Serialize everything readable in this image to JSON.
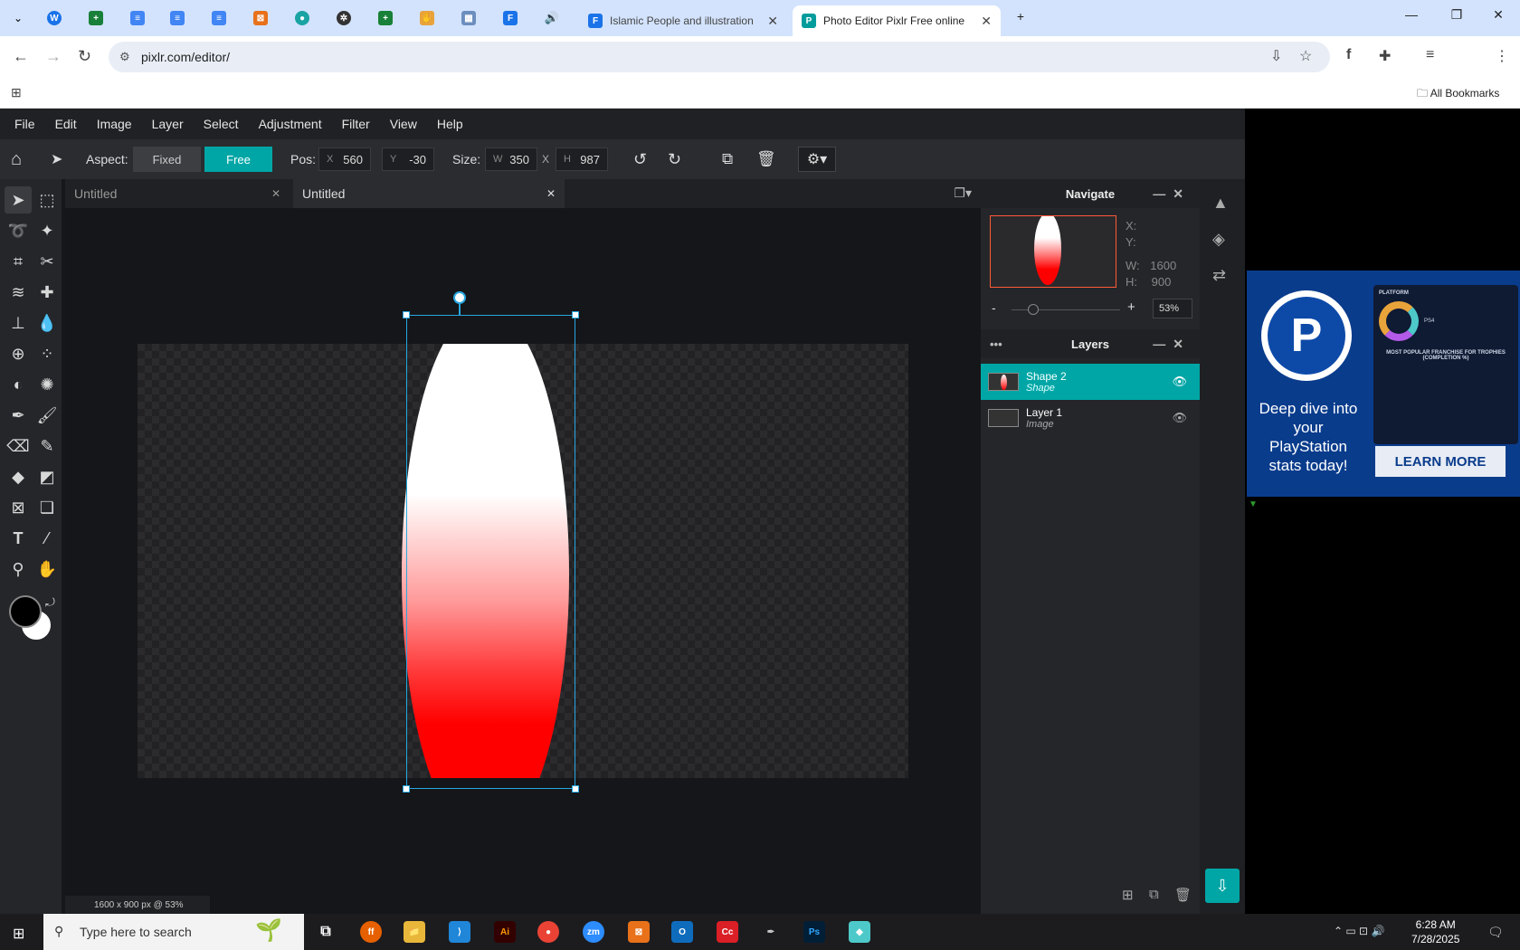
{
  "browser": {
    "tabs": [
      {
        "title": "Islamic People and illustration v"
      },
      {
        "title": "Photo Editor Pixlr Free online Ir"
      }
    ],
    "url": "pixlr.com/editor/",
    "bookmarks_label": "All Bookmarks"
  },
  "menu": [
    "File",
    "Edit",
    "Image",
    "Layer",
    "Select",
    "Adjustment",
    "Filter",
    "View",
    "Help"
  ],
  "options": {
    "aspect_label": "Aspect:",
    "fixed": "Fixed",
    "free": "Free",
    "pos_label": "Pos:",
    "x_label": "X",
    "x_value": "560",
    "y_label": "Y",
    "y_value": "-30",
    "size_label": "Size:",
    "w_label": "W",
    "w_value": "350",
    "h_label": "H",
    "h_value": "987",
    "x_sep": "X"
  },
  "doc_tabs": [
    {
      "title": "Untitled"
    },
    {
      "title": "Untitled"
    }
  ],
  "status": "1600 x 900 px @ 53%",
  "navigate": {
    "title": "Navigate",
    "x_label": "X:",
    "y_label": "Y:",
    "w_label": "W:",
    "w_value": "1600",
    "h_label": "H:",
    "h_value": "900",
    "zoom_minus": "-",
    "zoom_plus": "+",
    "zoom": "53%"
  },
  "layers": {
    "title": "Layers",
    "items": [
      {
        "name": "Shape 2",
        "type": "Shape",
        "selected": true
      },
      {
        "name": "Layer 1",
        "type": "Image",
        "selected": false
      }
    ]
  },
  "ad": {
    "logo": "P",
    "text": "Deep dive into your PlayStation stats today!",
    "button": "LEARN MORE",
    "card_title": "PLATFORM",
    "card_sub": "PS4",
    "card_heading": "MOST POPULAR FRANCHISE FOR TROPHIES (COMPLETION %)"
  },
  "taskbar": {
    "search_placeholder": "Type here to search",
    "time": "6:28 AM",
    "date": "7/28/2025"
  },
  "colors": {
    "accent": "#00a6a6",
    "selection": "#27a7e0",
    "shape_top": "#ffffff",
    "shape_bottom": "#ff0000"
  }
}
